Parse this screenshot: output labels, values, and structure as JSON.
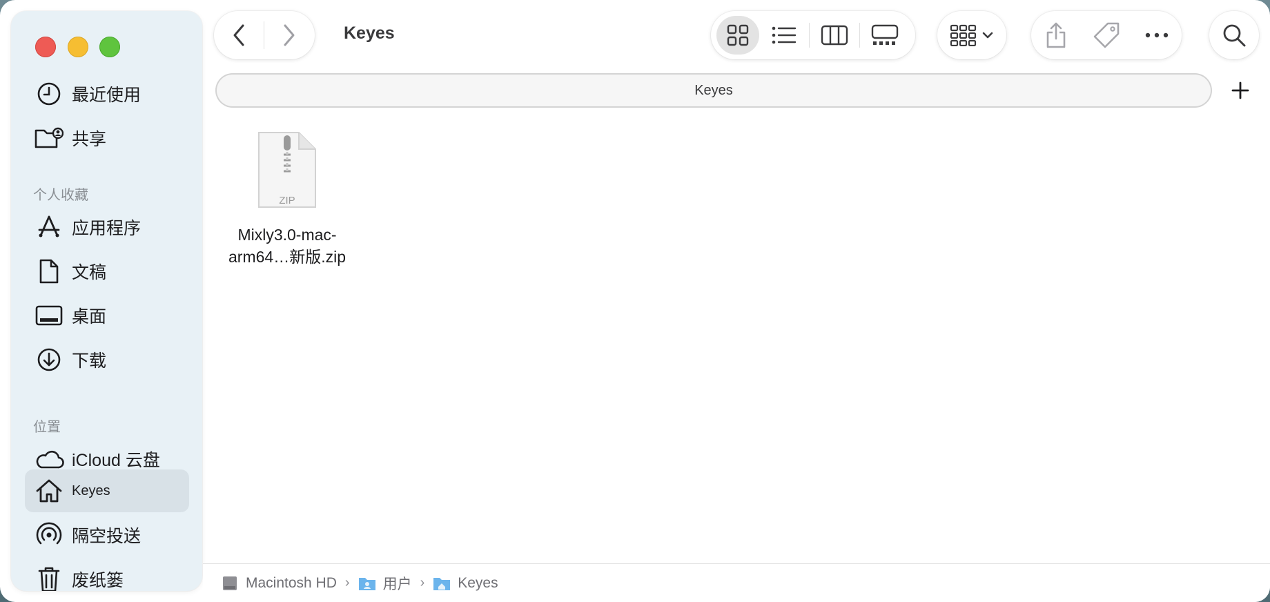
{
  "window": {
    "title": "Keyes"
  },
  "sidebar": {
    "items_top": [
      {
        "label": "最近使用",
        "icon": "clock-icon"
      },
      {
        "label": "共享",
        "icon": "shared-folder-icon"
      }
    ],
    "favorites_heading": "个人收藏",
    "favorites": [
      {
        "label": "应用程序",
        "icon": "applications-icon"
      },
      {
        "label": "文稿",
        "icon": "document-icon"
      },
      {
        "label": "桌面",
        "icon": "desktop-icon"
      },
      {
        "label": "下载",
        "icon": "download-icon"
      }
    ],
    "locations_heading": "位置",
    "locations": [
      {
        "label": "iCloud 云盘",
        "icon": "cloud-icon"
      },
      {
        "label": "Keyes",
        "icon": "home-icon",
        "selected": true
      },
      {
        "label": "隔空投送",
        "icon": "airdrop-icon"
      },
      {
        "label": "废纸篓",
        "icon": "trash-icon"
      }
    ]
  },
  "toolbar": {
    "view_modes": [
      "icon-view",
      "list-view",
      "column-view",
      "gallery-view"
    ],
    "selected_view": "icon-view"
  },
  "tabbar": {
    "tab_label": "Keyes"
  },
  "files": [
    {
      "name_line1": "Mixly3.0-mac-",
      "name_line2": "arm64…新版.zip",
      "badge": "ZIP",
      "icon": "zip-file-icon"
    }
  ],
  "path": {
    "segments": [
      "Macintosh HD",
      "用户",
      "Keyes"
    ]
  }
}
